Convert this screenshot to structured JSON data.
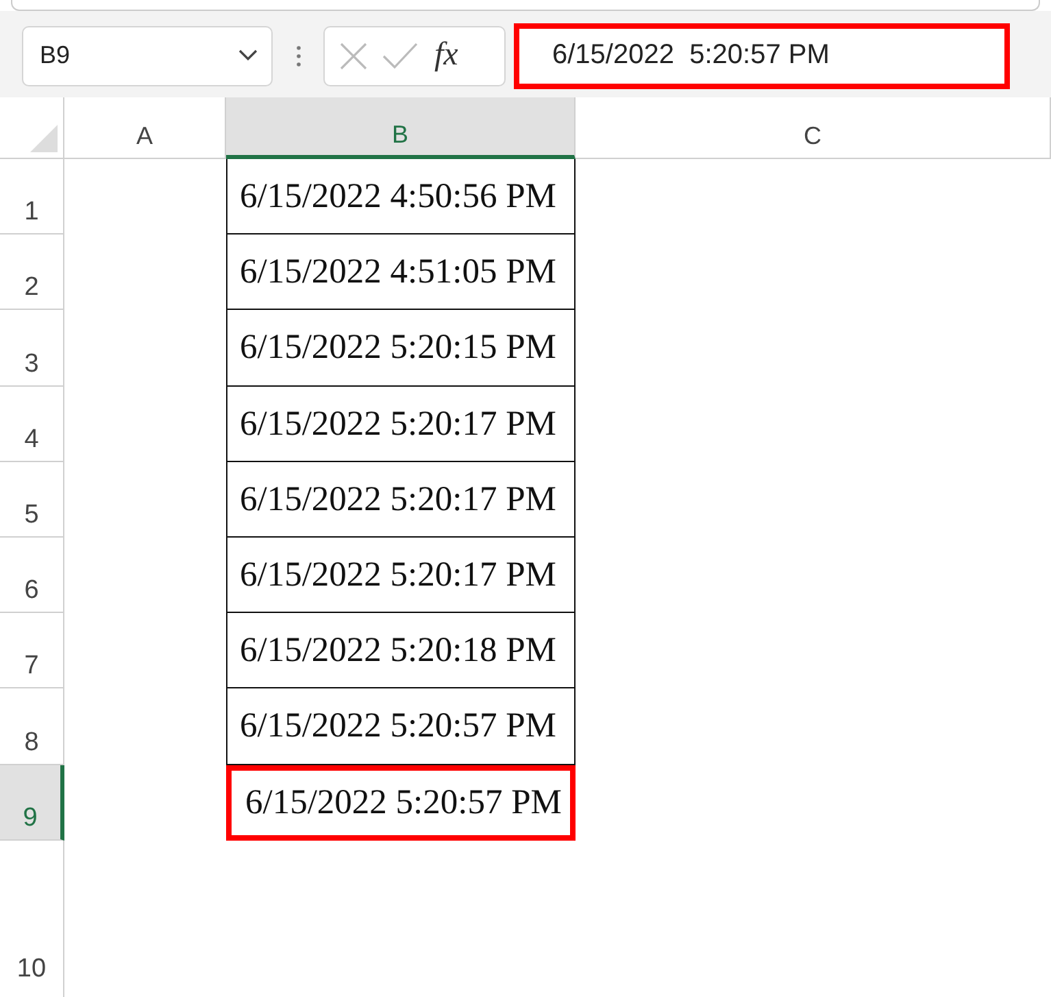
{
  "name_box": {
    "value": "B9"
  },
  "formula_bar": {
    "fx": "fx",
    "value": "6/15/2022  5:20:57 PM",
    "highlighted": true
  },
  "columns": [
    {
      "label": "A",
      "selected": false
    },
    {
      "label": "B",
      "selected": true
    },
    {
      "label": "C",
      "selected": false
    }
  ],
  "rows": [
    {
      "label": "1",
      "selected": false,
      "cell": {
        "value": "6/15/2022 4:50:56 PM",
        "highlighted": false
      }
    },
    {
      "label": "2",
      "selected": false,
      "cell": {
        "value": "6/15/2022 4:51:05 PM",
        "highlighted": false
      }
    },
    {
      "label": "3",
      "selected": false,
      "cell": {
        "value": "6/15/2022 5:20:15 PM",
        "highlighted": false
      }
    },
    {
      "label": "4",
      "selected": false,
      "cell": {
        "value": "6/15/2022 5:20:17 PM",
        "highlighted": false
      }
    },
    {
      "label": "5",
      "selected": false,
      "cell": {
        "value": "6/15/2022 5:20:17 PM",
        "highlighted": false
      }
    },
    {
      "label": "6",
      "selected": false,
      "cell": {
        "value": "6/15/2022 5:20:17 PM",
        "highlighted": false
      }
    },
    {
      "label": "7",
      "selected": false,
      "cell": {
        "value": "6/15/2022 5:20:18 PM",
        "highlighted": false
      }
    },
    {
      "label": "8",
      "selected": false,
      "cell": {
        "value": "6/15/2022 5:20:57 PM",
        "highlighted": false
      }
    },
    {
      "label": "9",
      "selected": true,
      "cell": {
        "value": "6/15/2022 5:20:57 PM",
        "highlighted": true
      }
    },
    {
      "label": "10",
      "selected": false
    }
  ]
}
